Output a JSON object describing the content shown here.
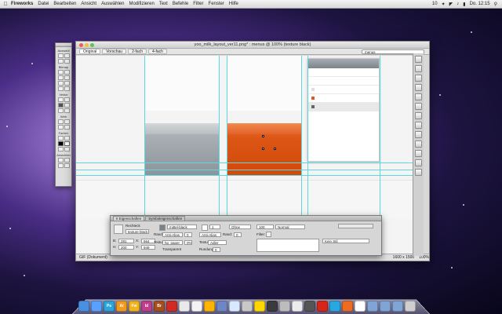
{
  "menubar": {
    "app_name": "Fireworks",
    "items": [
      "Datei",
      "Bearbeiten",
      "Ansicht",
      "Auswählen",
      "Modifizieren",
      "Text",
      "Befehle",
      "Filter",
      "Fenster",
      "Hilfe"
    ],
    "badge": "10",
    "clock": "Do. 12:15"
  },
  "window": {
    "title": "yoo_milk_layout_ver11.png* : menus @ 100% (texture black)",
    "view_tabs": [
      "Original",
      "Vorschau",
      "2-fach",
      "4-fach"
    ],
    "page_select": "menus"
  },
  "status": {
    "format": "GIF (Dokument)",
    "doc_size": "1600 x 1500",
    "zoom": "100%"
  },
  "tools": {
    "sections": [
      "Auswahl",
      "Bitmap",
      "Vektor",
      "Web",
      "Farben",
      "Ansichten"
    ]
  },
  "props": {
    "tabs": [
      "II Eigenschaften",
      "Symboleigenschaften"
    ],
    "object_type": "Rechteck",
    "object_name": "texture black",
    "b_label": "B:",
    "b_value": "281",
    "h_label": "H:",
    "h_value": "200",
    "x_label": "X:",
    "x_value": "664",
    "y_label": "Y:",
    "y_value": "949",
    "fill_label": "Rand",
    "fill_type": "Anti-Alias",
    "fill_value": "0",
    "stroke_kind": "Ohne",
    "pencil_size": "1",
    "rand_label": "Rand:",
    "rand_value": "0",
    "texture_label": "Textur:",
    "texture_value": "hp_paper",
    "texture_pct": "0%",
    "texture2_label": "Textur:",
    "texture2_value": "Adler",
    "transparent_label": "Transparent",
    "rundung_label": "Rundung:",
    "rundung_value": "0",
    "pen_label": "Anti-Alias",
    "blend_label": "Normal",
    "opacity": "100",
    "filter_label": "Filter:",
    "kein_stil": "Kein Stil",
    "fill_none": "Ohne",
    "fill_name": "mittel-black"
  }
}
